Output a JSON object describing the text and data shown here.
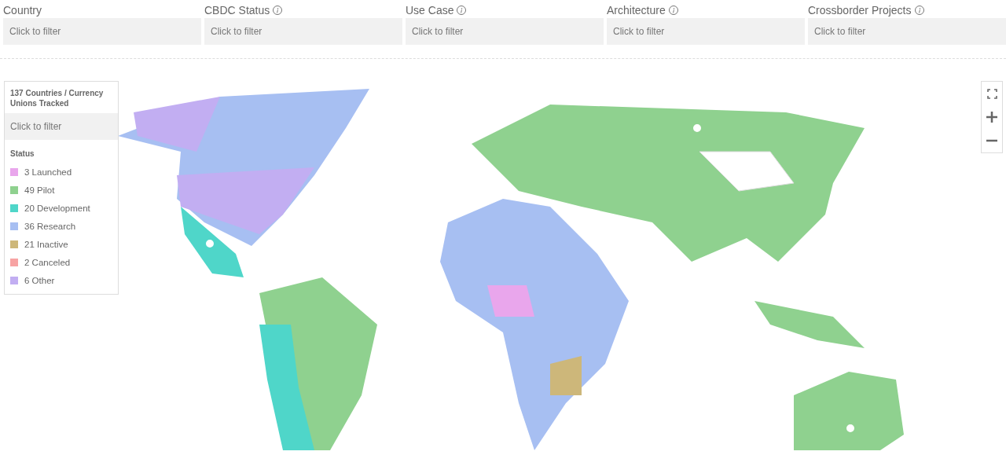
{
  "filters": [
    {
      "label": "Country",
      "info": false,
      "placeholder": "Click to filter"
    },
    {
      "label": "CBDC Status",
      "info": true,
      "placeholder": "Click to filter"
    },
    {
      "label": "Use Case",
      "info": true,
      "placeholder": "Click to filter"
    },
    {
      "label": "Architecture",
      "info": true,
      "placeholder": "Click to filter"
    },
    {
      "label": "Crossborder Projects",
      "info": true,
      "placeholder": "Click to filter"
    }
  ],
  "legend": {
    "title": "137 Countries / Currency Unions Tracked",
    "placeholder": "Click to filter",
    "heading": "Status",
    "items": [
      {
        "label": "3 Launched",
        "color": "#e9a6ec"
      },
      {
        "label": "49 Pilot",
        "color": "#8fd18f"
      },
      {
        "label": "20 Development",
        "color": "#4fd6c9"
      },
      {
        "label": "36 Research",
        "color": "#a7bff2"
      },
      {
        "label": "21 Inactive",
        "color": "#cdb77a"
      },
      {
        "label": "2 Canceled",
        "color": "#f7a3a3"
      },
      {
        "label": "6 Other",
        "color": "#c2aef2"
      }
    ]
  }
}
